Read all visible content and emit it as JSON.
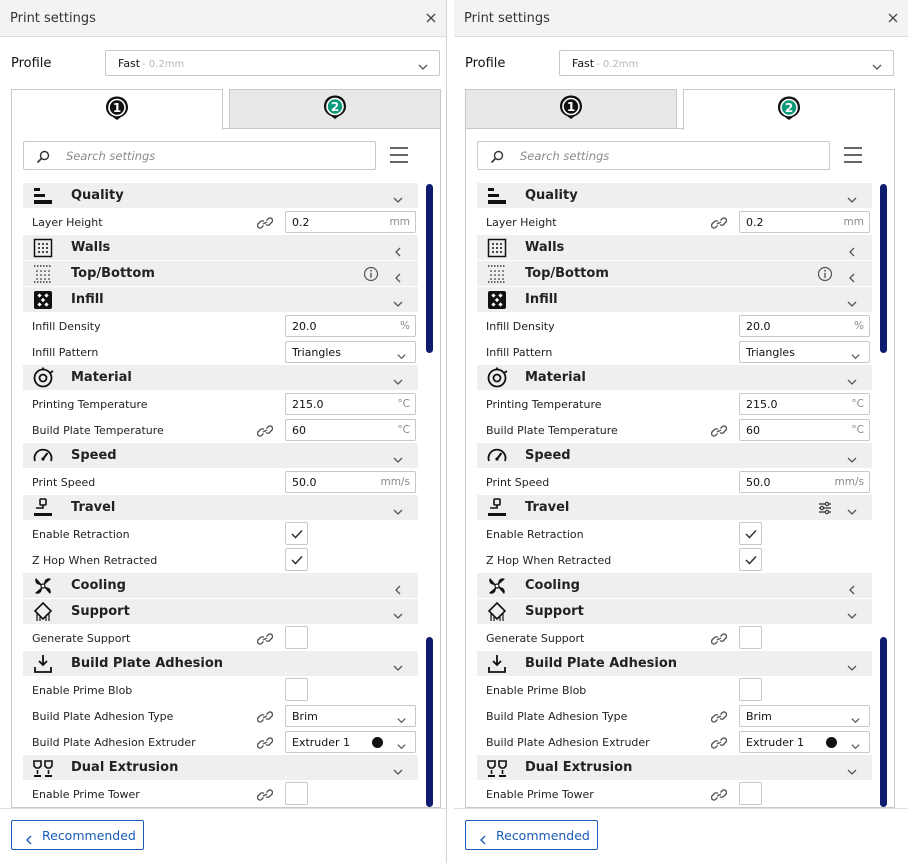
{
  "panels": [
    {
      "id": "left",
      "title": "Print settings",
      "profile_label": "Profile",
      "profile_value": "Fast",
      "profile_sub": "- 0.2mm",
      "active_tab": 1,
      "search_placeholder": "Search settings",
      "footer_button": "Recommended",
      "rows": [
        {
          "type": "cat",
          "label": "Quality",
          "icon": "quality-icon",
          "state": "expanded"
        },
        {
          "type": "set",
          "label": "Layer Height",
          "link": true,
          "kind": "num",
          "value": "0.2",
          "unit": "mm"
        },
        {
          "type": "cat",
          "label": "Walls",
          "icon": "walls-icon",
          "state": "collapsed"
        },
        {
          "type": "cat",
          "label": "Top/Bottom",
          "icon": "top-bottom-icon",
          "state": "collapsed",
          "info": true
        },
        {
          "type": "cat",
          "label": "Infill",
          "icon": "infill-icon",
          "state": "expanded"
        },
        {
          "type": "set",
          "label": "Infill Density",
          "kind": "num",
          "value": "20.0",
          "unit": "%"
        },
        {
          "type": "set",
          "label": "Infill Pattern",
          "kind": "select",
          "value": "Triangles"
        },
        {
          "type": "cat",
          "label": "Material",
          "icon": "material-icon",
          "state": "expanded"
        },
        {
          "type": "set",
          "label": "Printing Temperature",
          "kind": "num",
          "value": "215.0",
          "unit": "°C"
        },
        {
          "type": "set",
          "label": "Build Plate Temperature",
          "link": true,
          "kind": "num",
          "value": "60",
          "unit": "°C"
        },
        {
          "type": "cat",
          "label": "Speed",
          "icon": "speed-icon",
          "state": "expanded"
        },
        {
          "type": "set",
          "label": "Print Speed",
          "kind": "num",
          "value": "50.0",
          "unit": "mm/s"
        },
        {
          "type": "cat",
          "label": "Travel",
          "icon": "travel-icon",
          "state": "expanded"
        },
        {
          "type": "set",
          "label": "Enable Retraction",
          "kind": "check",
          "checked": true
        },
        {
          "type": "set",
          "label": "Z Hop When Retracted",
          "kind": "check",
          "checked": true
        },
        {
          "type": "cat",
          "label": "Cooling",
          "icon": "cooling-icon",
          "state": "collapsed"
        },
        {
          "type": "cat",
          "label": "Support",
          "icon": "support-icon",
          "state": "expanded"
        },
        {
          "type": "set",
          "label": "Generate Support",
          "link": true,
          "kind": "check",
          "checked": false
        },
        {
          "type": "cat",
          "label": "Build Plate Adhesion",
          "icon": "adhesion-icon",
          "state": "expanded"
        },
        {
          "type": "set",
          "label": "Enable Prime Blob",
          "kind": "check",
          "checked": false
        },
        {
          "type": "set",
          "label": "Build Plate Adhesion Type",
          "link": true,
          "kind": "select",
          "value": "Brim"
        },
        {
          "type": "set",
          "label": "Build Plate Adhesion Extruder",
          "link": true,
          "kind": "select",
          "value": "Extruder 1",
          "dot": "#111111"
        },
        {
          "type": "cat",
          "label": "Dual Extrusion",
          "icon": "dual-extrusion-icon",
          "state": "expanded"
        },
        {
          "type": "set",
          "label": "Enable Prime Tower",
          "link": true,
          "kind": "check",
          "checked": false
        }
      ]
    },
    {
      "id": "right",
      "title": "Print settings",
      "profile_label": "Profile",
      "profile_value": "Fast",
      "profile_sub": "- 0.2mm",
      "active_tab": 2,
      "search_placeholder": "Search settings",
      "footer_button": "Recommended",
      "rows": [
        {
          "type": "cat",
          "label": "Quality",
          "icon": "quality-icon",
          "state": "expanded"
        },
        {
          "type": "set",
          "label": "Layer Height",
          "link": true,
          "kind": "num",
          "value": "0.2",
          "unit": "mm"
        },
        {
          "type": "cat",
          "label": "Walls",
          "icon": "walls-icon",
          "state": "collapsed"
        },
        {
          "type": "cat",
          "label": "Top/Bottom",
          "icon": "top-bottom-icon",
          "state": "collapsed",
          "info": true
        },
        {
          "type": "cat",
          "label": "Infill",
          "icon": "infill-icon",
          "state": "expanded"
        },
        {
          "type": "set",
          "label": "Infill Density",
          "kind": "num",
          "value": "20.0",
          "unit": "%"
        },
        {
          "type": "set",
          "label": "Infill Pattern",
          "kind": "select",
          "value": "Triangles"
        },
        {
          "type": "cat",
          "label": "Material",
          "icon": "material-icon",
          "state": "expanded"
        },
        {
          "type": "set",
          "label": "Printing Temperature",
          "kind": "num",
          "value": "215.0",
          "unit": "°C"
        },
        {
          "type": "set",
          "label": "Build Plate Temperature",
          "link": true,
          "kind": "num",
          "value": "60",
          "unit": "°C"
        },
        {
          "type": "cat",
          "label": "Speed",
          "icon": "speed-icon",
          "state": "expanded"
        },
        {
          "type": "set",
          "label": "Print Speed",
          "kind": "num",
          "value": "50.0",
          "unit": "mm/s"
        },
        {
          "type": "cat",
          "label": "Travel",
          "icon": "travel-icon",
          "state": "expanded",
          "adjust": true
        },
        {
          "type": "set",
          "label": "Enable Retraction",
          "kind": "check",
          "checked": true
        },
        {
          "type": "set",
          "label": "Z Hop When Retracted",
          "kind": "check",
          "checked": true
        },
        {
          "type": "cat",
          "label": "Cooling",
          "icon": "cooling-icon",
          "state": "collapsed"
        },
        {
          "type": "cat",
          "label": "Support",
          "icon": "support-icon",
          "state": "expanded"
        },
        {
          "type": "set",
          "label": "Generate Support",
          "link": true,
          "kind": "check",
          "checked": false
        },
        {
          "type": "cat",
          "label": "Build Plate Adhesion",
          "icon": "adhesion-icon",
          "state": "expanded"
        },
        {
          "type": "set",
          "label": "Enable Prime Blob",
          "kind": "check",
          "checked": false
        },
        {
          "type": "set",
          "label": "Build Plate Adhesion Type",
          "link": true,
          "kind": "select",
          "value": "Brim"
        },
        {
          "type": "set",
          "label": "Build Plate Adhesion Extruder",
          "link": true,
          "kind": "select",
          "value": "Extruder 1",
          "dot": "#111111"
        },
        {
          "type": "cat",
          "label": "Dual Extrusion",
          "icon": "dual-extrusion-icon",
          "state": "expanded"
        },
        {
          "type": "set",
          "label": "Enable Prime Tower",
          "link": true,
          "kind": "check",
          "checked": false
        }
      ]
    }
  ],
  "tabs": [
    {
      "number": "1",
      "ring_color": "#111111"
    },
    {
      "number": "2",
      "ring_color": "#0c9a7a"
    }
  ],
  "colors": {
    "accent": "#1a5bb8",
    "scrollbar": "#0f1b6e",
    "category_bg": "#efefef"
  }
}
